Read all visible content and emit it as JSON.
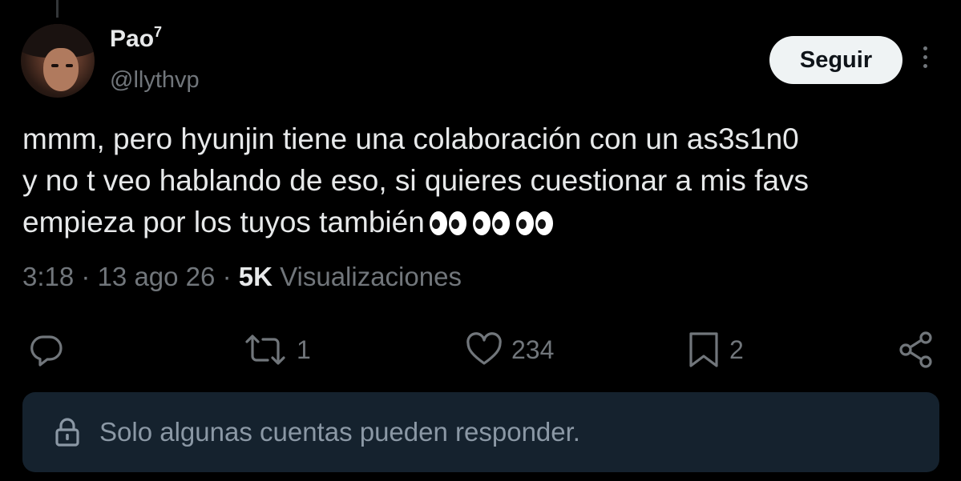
{
  "user": {
    "display_name": "Pao",
    "display_name_sup": "7",
    "handle": "@llythvp"
  },
  "follow_label": "Seguir",
  "tweet": {
    "text": "mmm, pero hyunjin tiene una colaboración con un as3s1n0\ny no t veo hablando de eso, si quieres cuestionar a mis favs\nempieza por los tuyos también"
  },
  "meta": {
    "time": "3:18",
    "sep1": "·",
    "date": "13 ago 26",
    "sep2": "·",
    "views_count": "5K",
    "views_label": "Visualizaciones"
  },
  "actions": {
    "replies": "",
    "retweets": "1",
    "likes": "234",
    "bookmarks": "2"
  },
  "icons": {
    "reply": "reply-icon",
    "retweet": "retweet-icon",
    "like": "heart-icon",
    "bookmark": "bookmark-icon",
    "share": "share-icon",
    "lock": "lock-icon",
    "more": "more-icon"
  },
  "reply_restriction": "Solo algunas cuentas pueden responder.",
  "colors": {
    "background": "#000000",
    "text": "#e7e9ea",
    "muted": "#71767b",
    "banner": "#15222e"
  }
}
